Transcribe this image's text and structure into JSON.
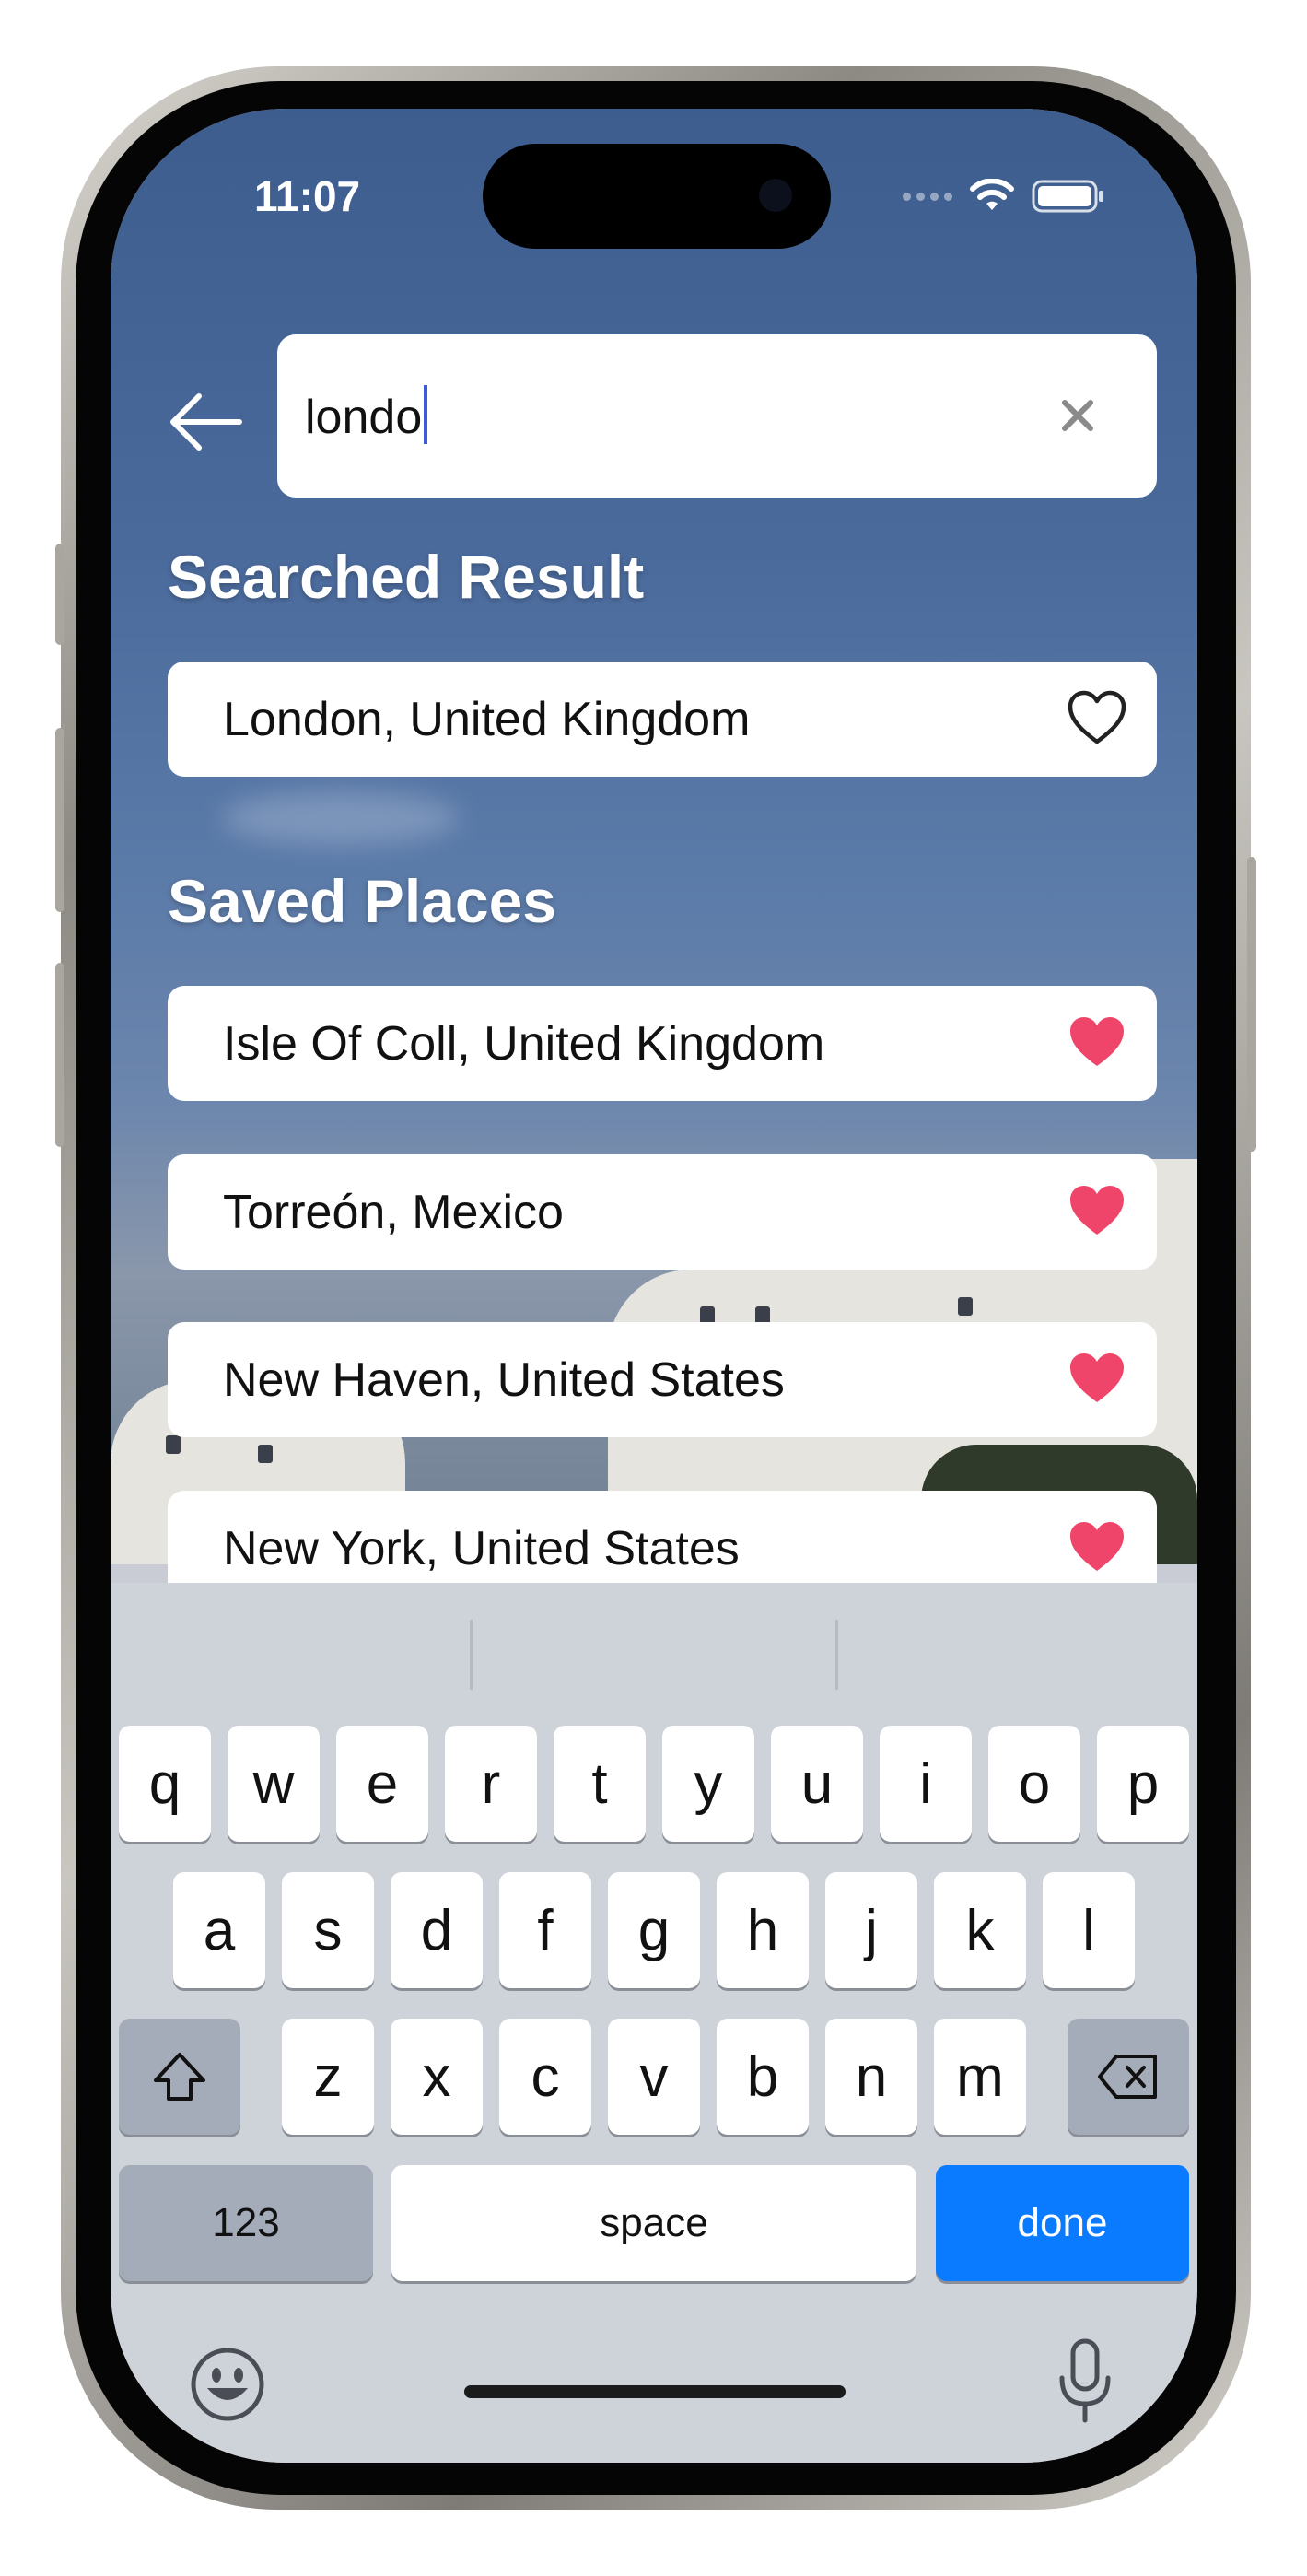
{
  "status_bar": {
    "time": "11:07"
  },
  "search": {
    "value": "londo"
  },
  "sections": {
    "searched_title": "Searched Result",
    "saved_title": "Saved Places"
  },
  "searched_results": [
    {
      "label": "London, United Kingdom",
      "favorited": false
    }
  ],
  "saved_places": [
    {
      "label": "Isle Of Coll, United Kingdom",
      "favorited": true
    },
    {
      "label": "Torreón, Mexico",
      "favorited": true
    },
    {
      "label": "New Haven, United States",
      "favorited": true
    },
    {
      "label": "New York, United States",
      "favorited": true
    }
  ],
  "keyboard": {
    "row1": [
      "q",
      "w",
      "e",
      "r",
      "t",
      "y",
      "u",
      "i",
      "o",
      "p"
    ],
    "row2": [
      "a",
      "s",
      "d",
      "f",
      "g",
      "h",
      "j",
      "k",
      "l"
    ],
    "row3": [
      "z",
      "x",
      "c",
      "v",
      "b",
      "n",
      "m"
    ],
    "numbers_label": "123",
    "space_label": "space",
    "done_label": "done"
  },
  "colors": {
    "accent": "#0a7bff",
    "heart": "#f0456a",
    "keyboard_bg": "#ced2d9"
  },
  "icons": {
    "back": "arrow-left-icon",
    "clear": "close-icon",
    "favorite": "heart-icon",
    "shift": "shift-icon",
    "delete": "backspace-icon",
    "emoji": "emoji-icon",
    "dictation": "microphone-icon"
  }
}
